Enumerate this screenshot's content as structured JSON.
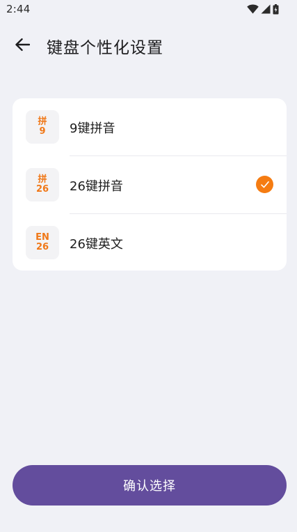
{
  "status_bar": {
    "time": "2:44",
    "icons": [
      "wifi-icon",
      "cellular-signal-icon",
      "battery-icon"
    ]
  },
  "header": {
    "back_icon": "arrow-left-icon",
    "title": "键盘个性化设置"
  },
  "options": [
    {
      "badge_top": "拼",
      "badge_bottom": "9",
      "label": "9键拼音",
      "selected": false
    },
    {
      "badge_top": "拼",
      "badge_bottom": "26",
      "label": "26键拼音",
      "selected": true
    },
    {
      "badge_top": "EN",
      "badge_bottom": "26",
      "label": "26键英文",
      "selected": false
    }
  ],
  "confirm_button": {
    "label": "确认选择"
  },
  "colors": {
    "background": "#f0f1f6",
    "accent": "#f57c12",
    "badge_text": "#f07818",
    "primary_button": "#634d9d"
  }
}
